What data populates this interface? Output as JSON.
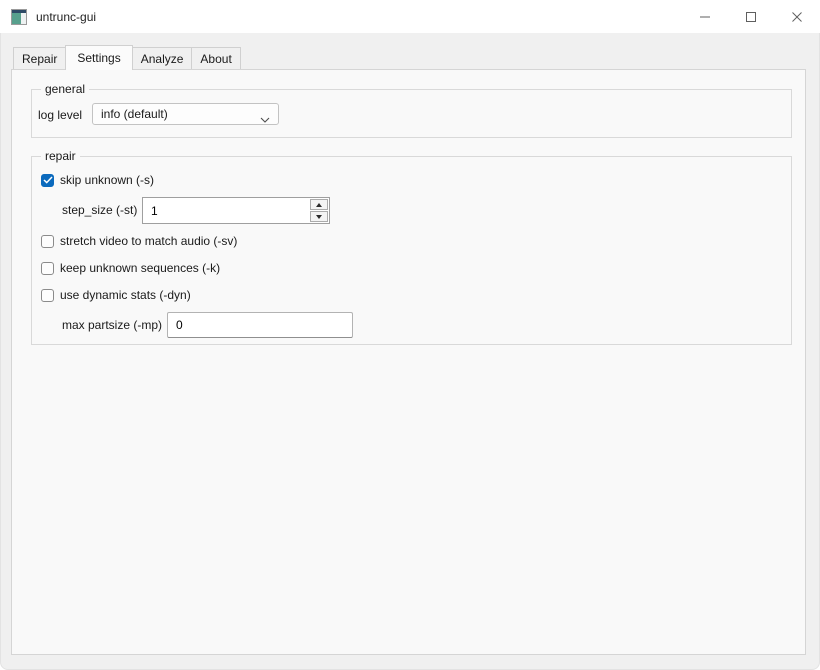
{
  "window": {
    "title": "untrunc-gui",
    "controls": [
      {
        "name": "minimize-icon"
      },
      {
        "name": "maximize-icon"
      },
      {
        "name": "close-icon"
      }
    ]
  },
  "tabs": [
    {
      "label": "Repair"
    },
    {
      "label": "Settings"
    },
    {
      "label": "Analyze"
    },
    {
      "label": "About"
    }
  ],
  "active_tab": "Settings",
  "groups": {
    "general": {
      "title": "general",
      "log_level": {
        "label": "log level",
        "value": "info (default)"
      }
    },
    "repair": {
      "title": "repair",
      "skip_unknown": {
        "label": "skip unknown (-s)",
        "checked": true
      },
      "step_size": {
        "label": "step_size (-st)",
        "value": "1"
      },
      "stretch_video": {
        "label": "stretch video to match audio (-sv)",
        "checked": false
      },
      "keep_unknown": {
        "label": "keep unknown sequences (-k)",
        "checked": false
      },
      "dynamic_stats": {
        "label": "use dynamic stats (-dyn)",
        "checked": false
      },
      "max_partsize": {
        "label": "max partsize (-mp)",
        "value": "0"
      }
    }
  },
  "colors": {
    "accent": "#0b6abd",
    "titlebar_bg": "#ffffff",
    "window_bg": "#f0f0f0",
    "pane_bg": "#f9f9f9"
  }
}
